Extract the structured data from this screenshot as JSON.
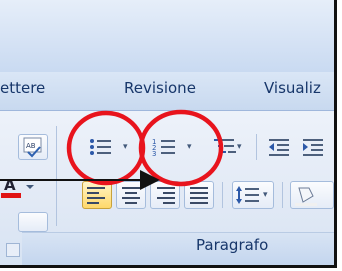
{
  "tabs": [
    "ettere",
    "Revisione",
    "Visualiz"
  ],
  "group": {
    "label": "Paragrafo"
  },
  "icons": {
    "spellcheck": "abc-check-icon",
    "font_color": "font-color-icon",
    "bullets": "bulleted-list-icon",
    "numbering": "numbered-list-icon",
    "multilevel": "multilevel-list-icon",
    "decrease_indent": "decrease-indent-icon",
    "increase_indent": "increase-indent-icon",
    "align_left": "align-left-icon",
    "align_center": "align-center-icon",
    "align_right": "align-right-icon",
    "justify": "justify-icon",
    "line_spacing": "line-spacing-icon",
    "shading": "shading-icon",
    "dialog_launcher": "dialog-launcher-icon"
  },
  "selected": {
    "align_left": true
  },
  "annotations": {
    "highlight_color": "#e8141d",
    "circled": [
      "bullets-button",
      "numbering-button"
    ],
    "arrow_target": "numbering-button"
  },
  "colors": {
    "tab_text": "#17366a",
    "ribbon_bg": "#e1e9f5",
    "selected_button": "#ffd86a"
  }
}
